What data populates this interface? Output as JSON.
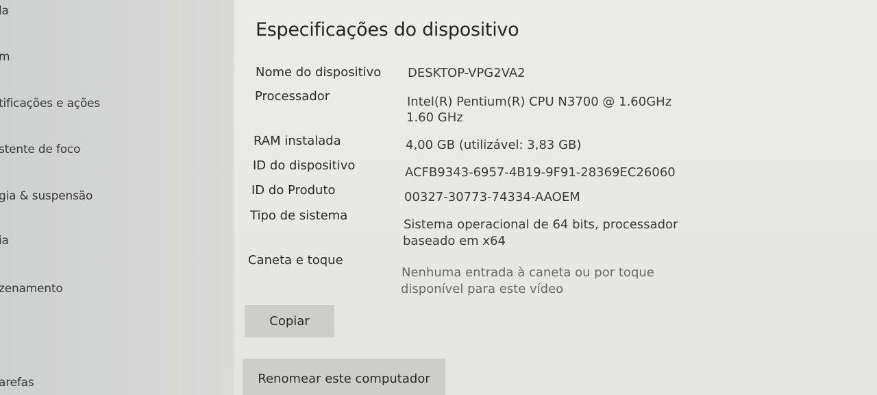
{
  "sidebar": {
    "items": [
      {
        "label": "la"
      },
      {
        "label": "m"
      },
      {
        "label": "tificações e ações"
      },
      {
        "label": "stente de foco"
      },
      {
        "label": "gia & suspensão"
      },
      {
        "label": "ia"
      },
      {
        "label": "zenamento"
      },
      {
        "label": "arefas"
      }
    ]
  },
  "main": {
    "title": "Especificações do dispositivo",
    "specs": [
      {
        "label": "Nome do dispositivo",
        "value": [
          "DESKTOP-VPG2VA2"
        ]
      },
      {
        "label": "Processador",
        "value": [
          "Intel(R) Pentium(R) CPU  N3700  @ 1.60GHz",
          "1.60 GHz"
        ]
      },
      {
        "label": "RAM instalada",
        "value": [
          "4,00 GB (utilizável: 3,83 GB)"
        ]
      },
      {
        "label": "ID do dispositivo",
        "value": [
          "ACFB9343-6957-4B19-9F91-28369EC26060"
        ]
      },
      {
        "label": "ID do Produto",
        "value": [
          "00327-30773-74334-AAOEM"
        ]
      },
      {
        "label": "Tipo de sistema",
        "value": [
          "Sistema operacional de 64 bits, processador",
          "baseado em x64"
        ]
      },
      {
        "label": "Caneta e toque",
        "value": [
          "Nenhuma entrada à caneta ou por toque",
          "disponível para este vídeo"
        ]
      }
    ],
    "buttons": {
      "copy_label": "Copiar",
      "rename_label": "Renomear este computador"
    }
  }
}
